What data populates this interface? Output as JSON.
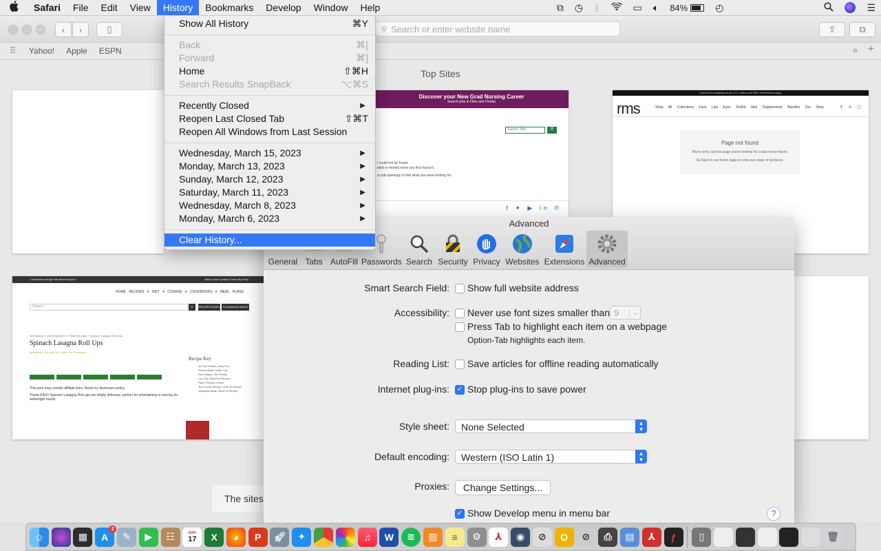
{
  "menubar": {
    "apple": "",
    "app": "Safari",
    "items": [
      "File",
      "Edit",
      "View",
      "History",
      "Bookmarks",
      "Develop",
      "Window",
      "Help"
    ],
    "battery_pct": "84%",
    "battery_level": 0.84
  },
  "safari": {
    "address_placeholder": "Search or enter website name",
    "bookmarks": [
      "Yahoo!",
      "Apple",
      "ESPN"
    ],
    "top_sites_title": "Top Sites",
    "sites_note": "The sites",
    "tiles": {
      "nursing": {
        "title": "Discover your New Grad Nursing Career",
        "subtitle": "Search jobs in Ohio and Florida",
        "search": "Search Jobs",
        "line1": "r could not be found.",
        "line2": "eted or moved since you first found it.",
        "line3": "ur job openings to find what you were looking for."
      },
      "rms": {
        "strip": "Unlock free shipping on all U.S. orders over $40. Restrictions apply.",
        "logo": "rms",
        "nav": "Shop All Collections Face Lips Eyes Toolkit Skin Supplements Bundles Our Story",
        "box_title": "Page not found",
        "box_text1": "We're sorry, but the page you're looking for could not be found.",
        "box_text2": "Go back to our home page or view our range of products."
      },
      "skinny": {
        "top_left": "→ Subscribe and get the latest recipes!",
        "top_right": "About Gina  Contact  Travel  My Shop",
        "nav": "HOME  RECIPES ▾  DIET ▾  COURSE ▾  COOKBOOKS ▾  MEAL PLANS",
        "search": "Search...",
        "btn1": "RECIPES INDEX",
        "btn2": "COOKBOOK INDEX",
        "crumb": "Skinnytaste > Main Ingredient > Pasta Recipes > Spinach Lasagna Roll Ups",
        "title": "Spinach Lasagna Roll Ups",
        "meta": "★★★★★ 4.89 from 133 votes  714 Comments",
        "disclosure": "This post may contain affiliate links. Read my disclosure policy.",
        "desc": "These EASY Spinach Lasagna Roll ups are totally delicious, perfect for entertaining or serving for weeknight meals.",
        "key_title": "Recipe Key",
        "key_items": "Air Fryer Recipes  Dairy Free\nFreezer Meals  Gluten Free\nKeto Recipes  Kid Friendly\nLow Carb  Meal Prep Recipes\nPaleo  Pressure Cooker\nSlow Cooker Recipes  Under 30 Minutes\nVegetarian Meals  Whole 30 Recipes"
      }
    }
  },
  "history_menu": {
    "show_all": {
      "label": "Show All History",
      "shortcut": "⌘Y"
    },
    "back": {
      "label": "Back",
      "shortcut": "⌘["
    },
    "forward": {
      "label": "Forward",
      "shortcut": "⌘]"
    },
    "home": {
      "label": "Home",
      "shortcut": "⇧⌘H"
    },
    "snapback": {
      "label": "Search Results SnapBack",
      "shortcut": "⌥⌘S"
    },
    "recently_closed": {
      "label": "Recently Closed"
    },
    "reopen_tab": {
      "label": "Reopen Last Closed Tab",
      "shortcut": "⇧⌘T"
    },
    "reopen_windows": {
      "label": "Reopen All Windows from Last Session"
    },
    "dates": [
      "Wednesday, March 15, 2023",
      "Monday, March 13, 2023",
      "Sunday, March 12, 2023",
      "Saturday, March 11, 2023",
      "Wednesday, March 8, 2023",
      "Monday, March 6, 2023"
    ],
    "clear": {
      "label": "Clear History..."
    }
  },
  "preferences": {
    "title": "Advanced",
    "tabs": [
      "General",
      "Tabs",
      "AutoFill",
      "Passwords",
      "Search",
      "Security",
      "Privacy",
      "Websites",
      "Extensions",
      "Advanced"
    ],
    "selected_tab": "Advanced",
    "smart_search": {
      "label": "Smart Search Field:",
      "option": "Show full website address",
      "checked": false
    },
    "accessibility": {
      "label": "Accessibility:",
      "option1": "Never use font sizes smaller than",
      "font_size": "9",
      "option2": "Press Tab to highlight each item on a webpage",
      "note": "Option-Tab highlights each item."
    },
    "reading_list": {
      "label": "Reading List:",
      "option": "Save articles for offline reading automatically"
    },
    "plugins": {
      "label": "Internet plug-ins:",
      "option": "Stop plug-ins to save power",
      "checked": true
    },
    "style_sheet": {
      "label": "Style sheet:",
      "value": "None Selected"
    },
    "encoding": {
      "label": "Default encoding:",
      "value": "Western (ISO Latin 1)"
    },
    "proxies": {
      "label": "Proxies:",
      "button": "Change Settings..."
    },
    "develop_menu": {
      "option": "Show Develop menu in menu bar",
      "checked": true
    },
    "help": "?"
  },
  "dock": {
    "mail_badge": "2",
    "calendar_month": "MAR",
    "calendar_day": "17"
  }
}
